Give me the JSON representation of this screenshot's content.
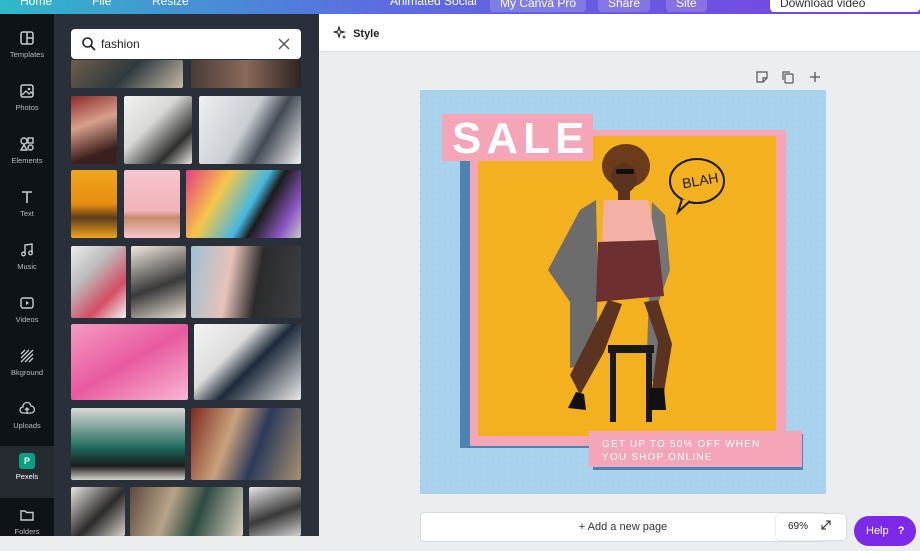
{
  "topbar": {
    "home": "Home",
    "file": "File",
    "resize": "Resize",
    "animated": "Animated Social",
    "team": "My Canva Pro",
    "share": "Share",
    "site": "Site",
    "download": "Download video"
  },
  "nav": [
    {
      "label": "Templates",
      "icon": "templates-icon"
    },
    {
      "label": "Photos",
      "icon": "photos-icon"
    },
    {
      "label": "Elements",
      "icon": "elements-icon"
    },
    {
      "label": "Text",
      "icon": "text-icon"
    },
    {
      "label": "Music",
      "icon": "music-icon"
    },
    {
      "label": "Videos",
      "icon": "videos-icon"
    },
    {
      "label": "Bkground",
      "icon": "background-icon"
    },
    {
      "label": "Uploads",
      "icon": "uploads-icon"
    },
    {
      "label": "Pexels",
      "icon": "pexels-icon",
      "badge": "P"
    },
    {
      "label": "Folders",
      "icon": "folders-icon"
    }
  ],
  "search": {
    "value": "fashion"
  },
  "toolbar": {
    "style_label": "Style"
  },
  "design": {
    "sale": "SALE",
    "blah": "BLAH",
    "promo_line1": "GET UP TO 50% OFF WHEN",
    "promo_line2": "YOU SHOP ONLINE"
  },
  "add_page": "+ Add a new page",
  "zoom": "69%",
  "help": "Help",
  "colors": {
    "accent": "#7d2ae8",
    "canvas_bg": "#a9d2ec",
    "frame_pink": "#f4a5b7",
    "frame_blue": "#4d83b0",
    "photo_yellow": "#f4b11f"
  }
}
